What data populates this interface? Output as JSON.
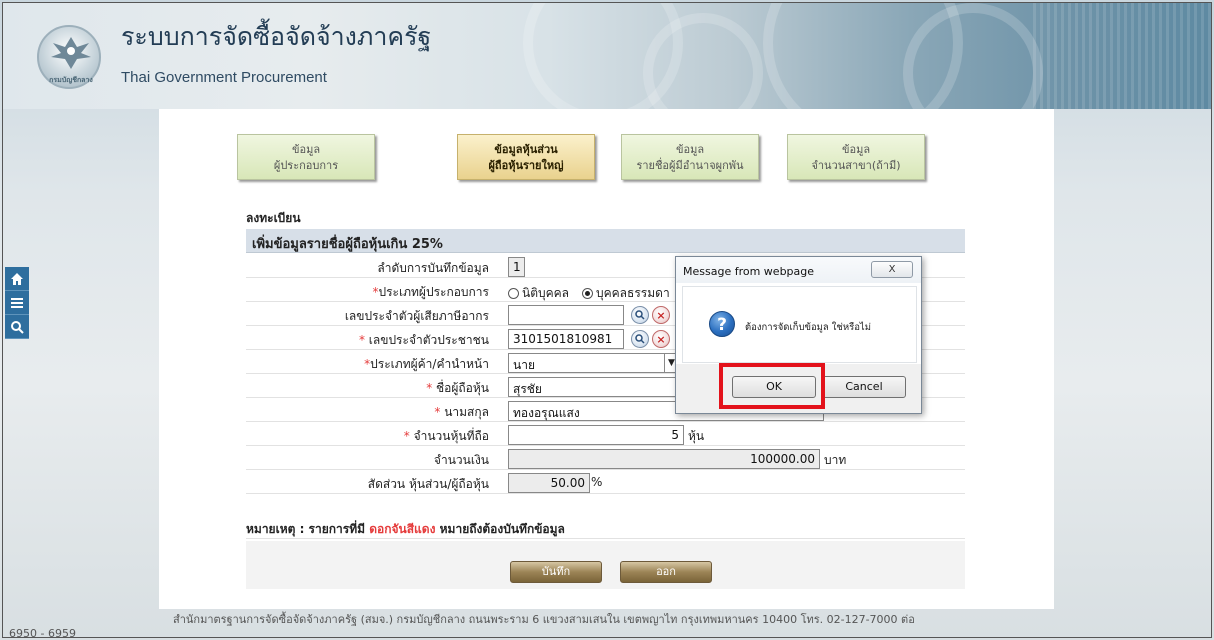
{
  "header": {
    "title": "ระบบการจัดซื้อจัดจ้างภาครัฐ",
    "subtitle": "Thai Government Procurement",
    "logo_text": "กรมบัญชีกลาง"
  },
  "side_nav": {
    "items": [
      "home-icon",
      "menu-icon",
      "search-icon"
    ]
  },
  "tabs": [
    {
      "line1": "ข้อมูล",
      "line2": "ผู้ประกอบการ"
    },
    {
      "line1": "ข้อมูลหุ้นส่วน",
      "line2": "ผู้ถือหุ้นรายใหญ่"
    },
    {
      "line1": "ข้อมูล",
      "line2": "รายชื่อผู้มีอำนาจผูกพัน"
    },
    {
      "line1": "ข้อมูล",
      "line2": "จำนวนสาขา(ถ้ามี)"
    }
  ],
  "section": {
    "register_label": "ลงทะเบียน",
    "heading": "เพิ่มข้อมูลรายชื่อผู้ถือหุ้นเกิน 25%"
  },
  "form": {
    "record_no_label": "ลำดับการบันทึกข้อมูล",
    "record_no_value": "1",
    "entity_type_label": "ประเภทผู้ประกอบการ",
    "entity_type_options": [
      "นิติบุคคล",
      "บุคคลธรรมดา"
    ],
    "tax_id_label": "เลขประจำตัวผู้เสียภาษีอากร",
    "tax_id_value": "",
    "citizen_id_label": "เลขประจำตัวประชาชน",
    "citizen_id_value": "3101501810981",
    "title_label": "ประเภทผู้ค้า/คำนำหน้า",
    "title_value": "นาย",
    "first_name_label": "ชื่อผู้ถือหุ้น",
    "first_name_value": "สุรชัย",
    "last_name_label": "นามสกุล",
    "last_name_value": "ทองอรุณแสง",
    "shares_label": "จำนวนหุ้นที่ถือ",
    "shares_value": "5",
    "shares_unit": "หุ้น",
    "amount_label": "จำนวนเงิน",
    "amount_value": "100000.00",
    "amount_unit": "บาท",
    "ratio_label": "สัดส่วน หุ้นส่วน/ผู้ถือหุ้น",
    "ratio_value": "50.00",
    "ratio_unit": "%",
    "required_mark": "*"
  },
  "note": {
    "prefix": "หมายเหตุ : รายการที่มี",
    "red": "ดอกจันสีแดง",
    "suffix": "หมายถึงต้องบันทึกข้อมูล"
  },
  "actions": {
    "save": "บันทึก",
    "exit": "ออก"
  },
  "footer": {
    "line1": "สำนักมาตรฐานการจัดซื้อจัดจ้างภาครัฐ (สมจ.) กรมบัญชีกลาง ถนนพระราม 6 แขวงสามเสนใน เขตพญาไท กรุงเทพมหานคร 10400 โทร. 02-127-7000 ต่อ",
    "line2": "6950 - 6959"
  },
  "dialog": {
    "title": "Message from webpage",
    "close": "X",
    "message": "ต้องการจัดเก็บข้อมูล ใช่หรือไม่",
    "ok": "OK",
    "cancel": "Cancel"
  },
  "colors": {
    "required": "#e53b3b",
    "highlight": "#e3121b",
    "nav": "#2e6e9e"
  }
}
